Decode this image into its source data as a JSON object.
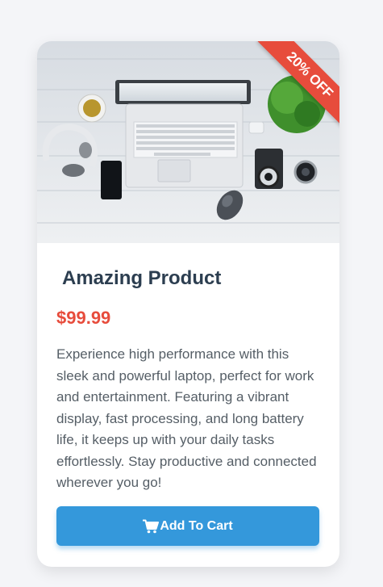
{
  "product": {
    "badge": "20% OFF",
    "title": "Amazing Product",
    "price": "$99.99",
    "description": "Experience high performance with this sleek and powerful laptop, perfect for work and entertainment. Featuring a vibrant display, fast processing, and long battery life, it keeps up with your daily tasks effortlessly. Stay productive and connected wherever you go!",
    "add_to_cart_label": "Add To Cart",
    "image_description": "laptop-desk-photo",
    "cart_icon": "shopping-cart-icon"
  },
  "colors": {
    "accent": "#3498db",
    "badge": "#e74c3c",
    "price": "#e74c3c",
    "title": "#2c3e50",
    "text": "#555e66",
    "background": "#f4f5f8"
  }
}
